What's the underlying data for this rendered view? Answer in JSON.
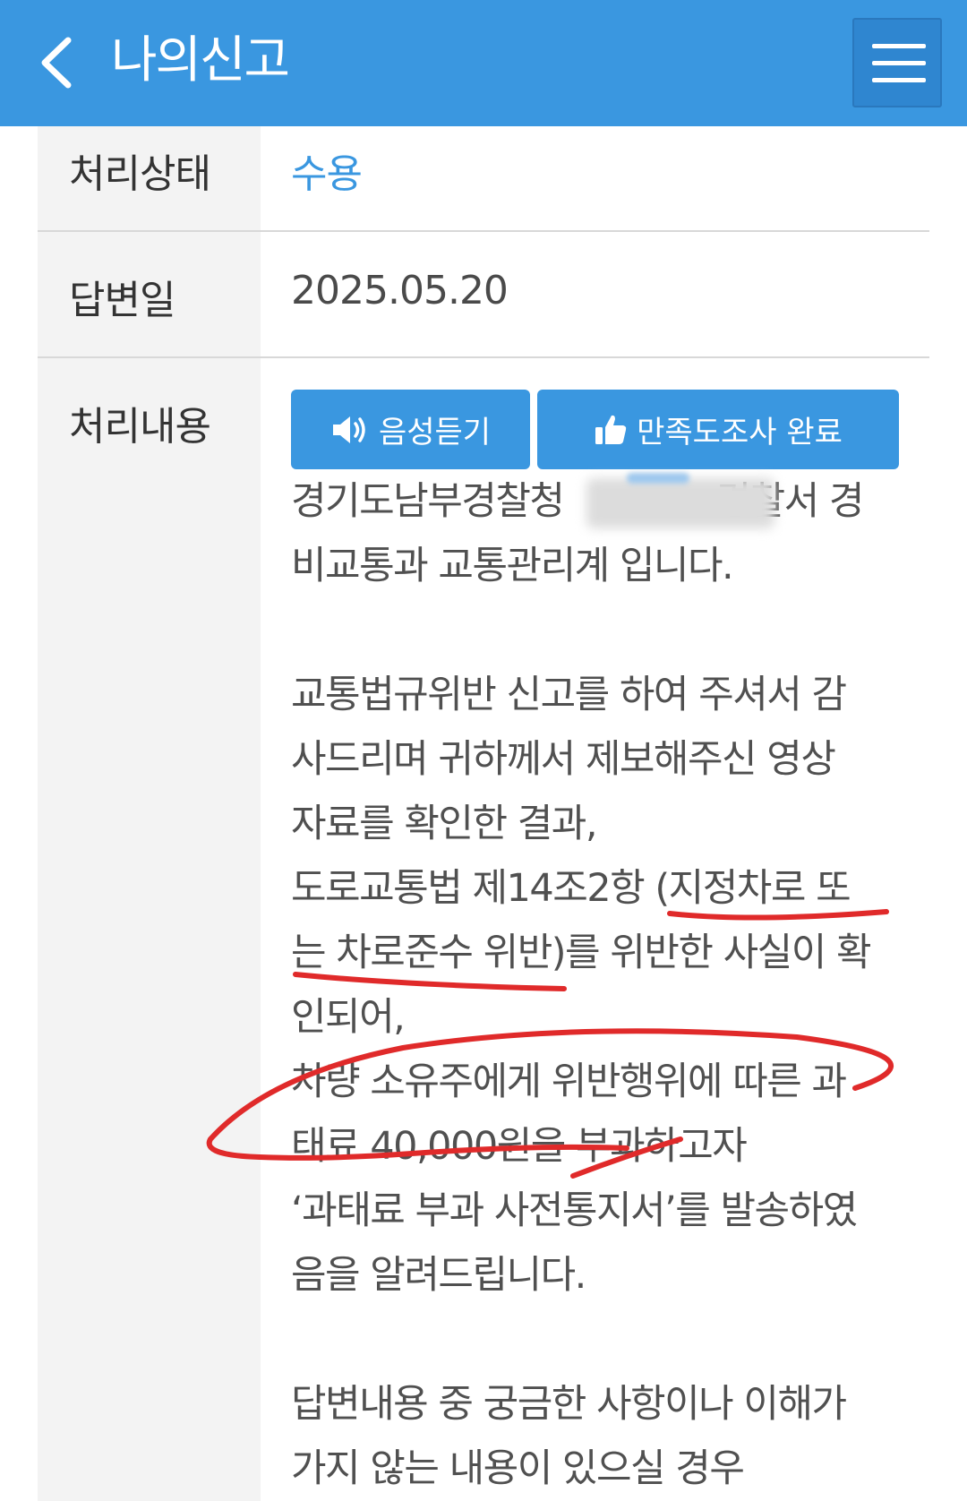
{
  "header": {
    "title": "나의신고",
    "back_icon": "chevron-left-icon",
    "menu_icon": "hamburger-menu-icon",
    "color": "#3a97e0"
  },
  "rows": {
    "status": {
      "label": "처리상태",
      "value": "수용"
    },
    "answer_date": {
      "label": "답변일",
      "value": "2025.05.20"
    },
    "content": {
      "label": "처리내용"
    }
  },
  "buttons": {
    "voice": {
      "label": "음성듣기",
      "icon": "speaker-icon"
    },
    "survey": {
      "label": "만족도조사 완료",
      "icon": "thumbs-up-icon"
    }
  },
  "body": {
    "line1": "경기도남부경찰청",
    "line1_end": "경찰서 경",
    "line2": "비교통과 교통관리계 입니다.",
    "line3": "교통법규위반 신고를 하여 주셔서 감",
    "line4": "사드리며 귀하께서 제보해주신 영상",
    "line5": "자료를 확인한 결과,",
    "line6": "도로교통법 제14조2항 (지정차로 또",
    "line7": "는 차로준수 위반)를 위반한 사실이 확",
    "line8": "인되어,",
    "line9": "차량 소유주에게 위반행위에 따른 과",
    "line10": "태료 40,000원을 부과하고자",
    "line11": "‘과태료 부과 사전통지서’를 발송하였",
    "line12": "음을 알려드립니다.",
    "line13": "답변내용 중 궁금한 사항이나 이해가",
    "line14": "가지 않는 내용이 있으실 경우"
  },
  "annotation_color": "#e02a2a"
}
